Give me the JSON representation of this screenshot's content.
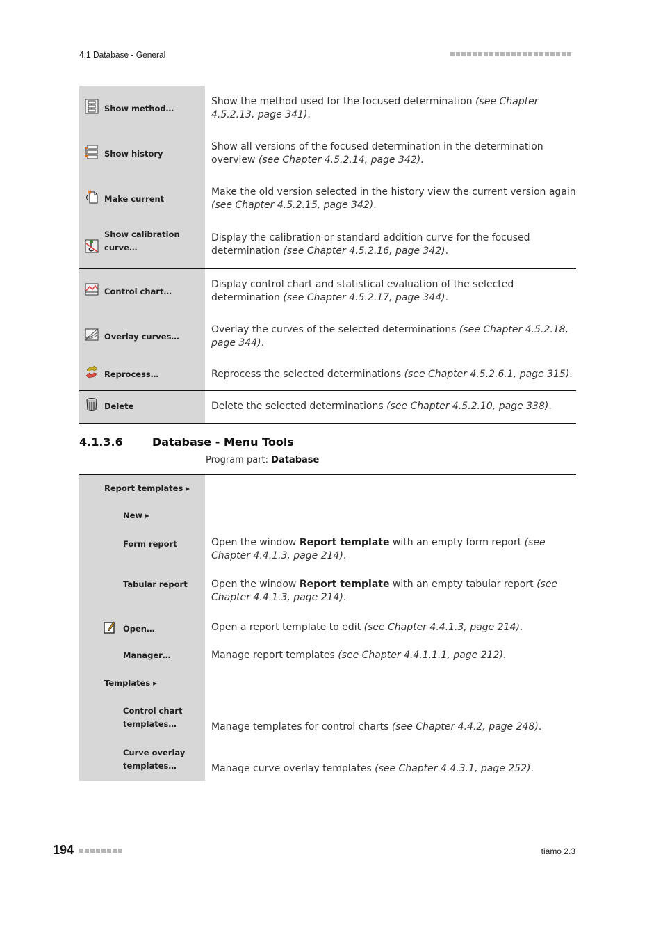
{
  "header": {
    "section": "4.1 Database - General"
  },
  "commands_table": {
    "rows": [
      {
        "icon": "show-method-icon",
        "label": "Show method…",
        "desc": "Show the method used for the focused determination ",
        "ref": "(see Chapter 4.5.2.13, page 341)",
        "end": "."
      },
      {
        "icon": "show-history-icon",
        "label": "Show history",
        "desc": "Show all versions of the focused determination in the determination overview ",
        "ref": "(see Chapter 4.5.2.14, page 342)",
        "end": "."
      },
      {
        "icon": "make-current-icon",
        "label": "Make current",
        "desc": "Make the old version selected in the history view the current version again ",
        "ref": "(see Chapter 4.5.2.15, page 342)",
        "end": "."
      },
      {
        "icon": "calibration-curve-icon",
        "label": "Show calibration curve…",
        "desc": "Display the calibration or standard addition curve for the focused determination ",
        "ref": "(see Chapter 4.5.2.16, page 342)",
        "end": "."
      },
      {
        "icon": "control-chart-icon",
        "label": "Control chart…",
        "desc": "Display control chart and statistical evaluation of the selected determination ",
        "ref": "(see Chapter 4.5.2.17, page 344)",
        "end": "."
      },
      {
        "icon": "overlay-curves-icon",
        "label": "Overlay curves…",
        "desc": "Overlay the curves of the selected determinations ",
        "ref": "(see Chapter 4.5.2.18, page 344)",
        "end": "."
      },
      {
        "icon": "reprocess-icon",
        "label": "Reprocess…",
        "desc": "Reprocess the selected determinations ",
        "ref": "(see Chapter 4.5.2.6.1, page 315)",
        "end": "."
      },
      {
        "icon": "delete-icon",
        "label": "Delete",
        "desc": "Delete the selected determinations ",
        "ref": "(see Chapter 4.5.2.10, page 338)",
        "end": "."
      }
    ]
  },
  "section": {
    "number": "4.1.3.6",
    "title": "Database - Menu Tools",
    "program_part_label": "Program part: ",
    "program_part_value": "Database"
  },
  "tools_table": {
    "rows": [
      {
        "label": "Report templates ▸",
        "level": 1
      },
      {
        "label": "New ▸",
        "level": 2
      },
      {
        "label": "Form report",
        "level": 2,
        "desc_a": "Open the window ",
        "bold": "Report template",
        "desc_b": " with an empty form report ",
        "ref": "(see Chapter 4.4.1.3, page 214)",
        "end": "."
      },
      {
        "label": "Tabular report",
        "level": 2,
        "desc_a": "Open the window ",
        "bold": "Report template",
        "desc_b": " with an empty tabular report ",
        "ref": "(see Chapter 4.4.1.3, page 214)",
        "end": "."
      },
      {
        "label": "Open…",
        "level": 2,
        "icon": "edit-document-icon",
        "desc_a": "Open a report template to edit ",
        "ref": "(see Chapter 4.4.1.3, page 214)",
        "end": "."
      },
      {
        "label": "Manager…",
        "level": 2,
        "desc_a": "Manage report templates ",
        "ref": "(see Chapter 4.4.1.1.1, page 212)",
        "end": "."
      },
      {
        "label": "Templates ▸",
        "level": 1
      },
      {
        "label": "Control chart templates…",
        "level": 2,
        "desc_a": "Manage templates for control charts ",
        "ref": "(see Chapter 4.4.2, page 248)",
        "end": "."
      },
      {
        "label": "Curve overlay templates…",
        "level": 2,
        "desc_a": "Manage curve overlay templates ",
        "ref": "(see Chapter 4.4.3.1, page 252)",
        "end": "."
      }
    ]
  },
  "footer": {
    "page_number": "194",
    "product": "tiamo 2.3"
  }
}
